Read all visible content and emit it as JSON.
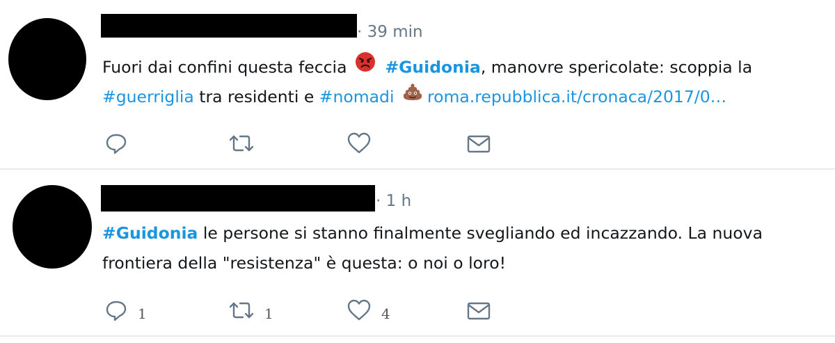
{
  "tweets": [
    {
      "time": "· 39 min",
      "text": {
        "p1": "Fuori dai confini questa feccia",
        "emoji1": "angry-face-emoji",
        "hashtag1": "#Guidonia",
        "p2": ", manovre spericolate: scoppia la",
        "hashtag2": "#guerriglia",
        "p3": " tra residenti e ",
        "hashtag3": "#nomadi",
        "emoji2": "pile-of-poo-emoji",
        "link": "roma.repubblica.it/cronaca/2017/0…"
      },
      "actions": {
        "reply_icon": "reply-icon",
        "retweet_icon": "retweet-icon",
        "like_icon": "heart-icon",
        "dm_icon": "envelope-icon"
      }
    },
    {
      "time": "· 1 h",
      "text": {
        "hashtag1": "#Guidonia",
        "p1": " le persone si stanno finalmente svegliando ed incazzando. La nuova",
        "p2": "frontiera della \"resistenza\" è questa: o noi o loro!"
      },
      "actions": {
        "reply_count": "1",
        "retweet_count": "1",
        "like_count": "4",
        "reply_icon": "reply-icon",
        "retweet_icon": "retweet-icon",
        "like_icon": "heart-icon",
        "dm_icon": "envelope-icon"
      }
    }
  ],
  "colors": {
    "hashtag": "#1b95e0",
    "meta": "#657786",
    "text": "#14171a",
    "divider": "#e6ecf0"
  }
}
